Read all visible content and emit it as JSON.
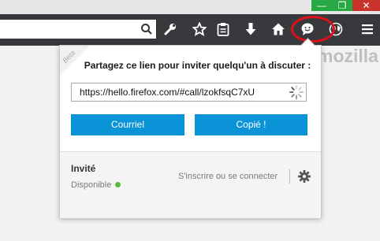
{
  "window": {
    "minimize_glyph": "—",
    "maximize_glyph": "❐",
    "close_glyph": "✕"
  },
  "toolbar": {
    "icons": [
      "search-icon",
      "wrench-icon",
      "star-icon",
      "clipboard-icon",
      "download-icon",
      "home-icon",
      "chat-icon",
      "globe-icon",
      "menu-icon"
    ]
  },
  "brand": {
    "text": "mozilla"
  },
  "panel": {
    "beta": "Beta",
    "heading": "Partagez ce lien pour inviter quelqu'un à discuter :",
    "link": "https://hello.firefox.com/#call/lzokfsqC7xU",
    "email_button": "Courriel",
    "copy_button": "Copié !",
    "user": {
      "name": "Invité",
      "status": "Disponible",
      "status_color": "#57bd35"
    },
    "signin": "S'inscrire ou se connecter"
  },
  "colors": {
    "accent": "#0b93d8",
    "toolbar": "#37393c",
    "highlight": "#e0101a"
  }
}
